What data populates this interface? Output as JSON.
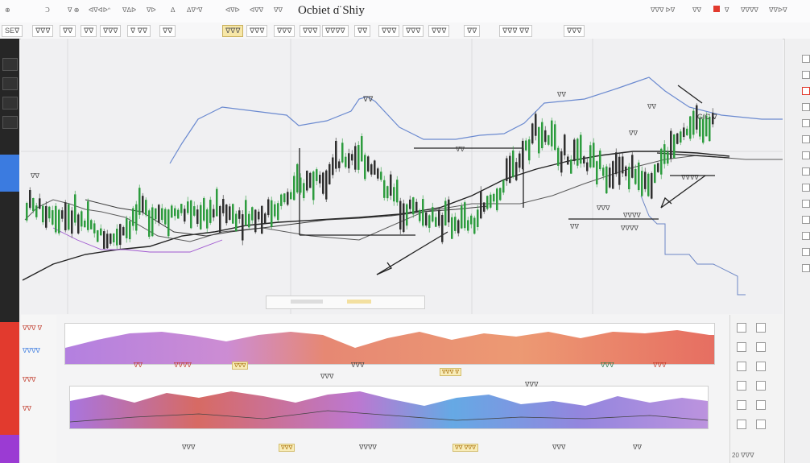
{
  "window": {
    "title": "Ocbiet ɑ̈ Shiy"
  },
  "colors": {
    "up": "#2d9c3e",
    "down": "#2f2f2f",
    "ma_blue": "#5b79c8",
    "accent_red": "#e23a2e",
    "accent_blue": "#3b7be0",
    "accent_purple": "#9b3bd3"
  },
  "topbar": {
    "left_items": [
      "⊕",
      "ᑐ",
      "ᐁ ⊕",
      "ᐊᐁᐊᐅᐢ",
      "ᐁᐃᐅ",
      "ᐁᐅ",
      "ᐃ",
      "ᐃᐁᐢᐁ",
      "ᐊᐁᐅ",
      "ᐊᐁᐁ",
      "ᐁᐁ"
    ],
    "right_items": [
      "ᐁᐁᐁ ᐅᐁ",
      "ᐁᐁ",
      "ᐁ",
      "ᐁᐁᐁᐁ",
      "ᐁᐁᐅᐁ"
    ]
  },
  "toolbar": {
    "items": [
      "SEᐁ",
      "ᐁᐁᐁ",
      "ᐁᐁ",
      "ᐁᐁ",
      "ᐁᐁᐁ",
      "ᐁ ᐁᐁ",
      "ᐁᐁ",
      "ᐁᐁᐁ",
      "ᐁᐁᐁ",
      "ᐁᐁᐁ",
      "ᐁᐁᐁ",
      "ᐁᐁᐁᐁ",
      "ᐁᐁ",
      "ᐁᐁᐁ",
      "ᐁᐁᐁ",
      "ᐁᐁᐁ",
      "ᐁᐁ",
      "ᐁᐁᐁ ᐁᐁ",
      "ᐁᐁᐁ"
    ],
    "highlighted_index": 7
  },
  "chart_labels": {
    "l1": "ᐁᐁ",
    "l2": "GIC ᐁ",
    "l3": "ᐁᐁ",
    "l4": "ᐁᐁ",
    "l5": "ᐁᐁ",
    "l6": "ᐁᐁ",
    "l7": "ᐁᐁ",
    "l8": "ᐁᐁᐁ",
    "l9": "ᐁᐁᐁᐁ",
    "l10": "ᐁᐁᐁᐁ",
    "l11": "ᐁᐁ",
    "l12": "ᐁᐁᐁᐁ"
  },
  "right_sidebar": {
    "icons": [
      "◫",
      "◫",
      "◫",
      "◫",
      "◫",
      "◫",
      "◫",
      "◫",
      "◫",
      "◫",
      "◫",
      "◫",
      "◫",
      "◫"
    ]
  },
  "indicators": {
    "panel1_labels": [
      "ᐁᐁᐁ",
      "ᐁᐁᐁ ᐁ",
      "ᐁᐁ",
      "ᐁᐁᐁᐁ",
      "ᐁᐁᐁ",
      "ᐁᐁᐁ",
      "ᐁᐁᐁ"
    ],
    "panel2_labels": [
      "ᐁᐁᐁ",
      "ᐁᐁᐁ",
      "ᐁᐁᐁ ᐁ",
      "ᐁᐁᐁᐁ",
      "ᐁᐁᐁ",
      "ᐁᐁ"
    ],
    "bottom_labels": [
      "ᐁᐁᐁ",
      "ᐁᐁ ᐁᐁᐁ",
      "ᐁᐁᐁ",
      "ᐁᐁᐁᐁ",
      "ᐁᐁᐁ",
      "ᐁᐁ"
    ]
  },
  "status": {
    "bottom_right": "20 ᐁᐁᐁ"
  }
}
